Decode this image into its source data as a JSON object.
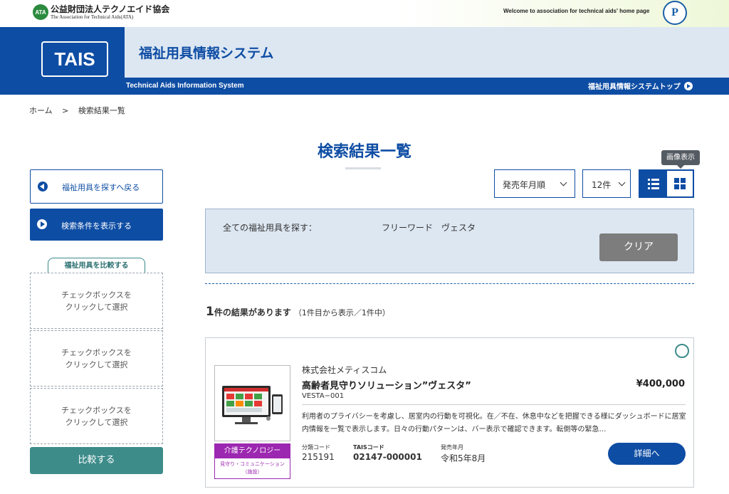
{
  "top_bar": {
    "ata_mark": "ATA",
    "org_name": "公益財団法人テクノエイド協会",
    "org_name_en": "The Association for Technical Aids(ATA)",
    "welcome": "Welcome to association for technical aids' home page",
    "pmark_letter": "P"
  },
  "header": {
    "logo": "TAIS",
    "title": "福祉用具情報システム",
    "subtitle": "Technical Aids Information System",
    "top_link": "福祉用具情報システムトップ"
  },
  "breadcrumb": {
    "items": [
      "ホーム",
      ">",
      "検索結果一覧"
    ]
  },
  "page_title": "検索結果一覧",
  "sidebar": {
    "back_label": "福祉用具を探すへ戻る",
    "show_conditions_label": "検索条件を表示する",
    "compare_tab": "福祉用具を比較する",
    "compare_slots": [
      {
        "line1": "チェックボックスを",
        "line2": "クリックして選択"
      },
      {
        "line1": "チェックボックスを",
        "line2": "クリックして選択"
      },
      {
        "line1": "チェックボックスを",
        "line2": "クリックして選択"
      }
    ],
    "compare_button": "比較する"
  },
  "controls": {
    "tooltip": "画像表示",
    "sort_value": "発売年月順",
    "count_value": "12件",
    "view_mode": "list"
  },
  "search_summary": {
    "label": "全ての福祉用具を探す：",
    "value": "フリーワード　ヴェスタ",
    "clear_button": "クリア"
  },
  "results": {
    "count": "1",
    "count_suffix": "件の結果があります",
    "range": "（1件目から表示／1件中）"
  },
  "item": {
    "maker": "株式会社メティスコム",
    "name": "高齢者見守りソリューション”ヴェスタ”",
    "price": "¥400,000",
    "code": "VESTA−001",
    "description": "利用者のプライバシーを考慮し、居室内の行動を可視化。在／不在、休息中などを把握できる様にダッシュボードに居室内情報を一覧で表示します。日々の行動パターンは、バー表示で確認できます。転倒等の緊急…",
    "category_main": "介護テクノロジー",
    "category_sub": "見守り・コミュニケーション（施設）",
    "class_code_label": "分類コード",
    "class_code": "215191",
    "tais_code_label": "TAISコード",
    "tais_code": "02147-000001",
    "release_label": "発売年月",
    "release": "令和5年8月",
    "detail_button": "詳細へ"
  },
  "colors": {
    "primary": "#0e4da4",
    "header_light": "#dde7f2",
    "teal": "#3d8c8a",
    "category": "#9c27b0"
  }
}
